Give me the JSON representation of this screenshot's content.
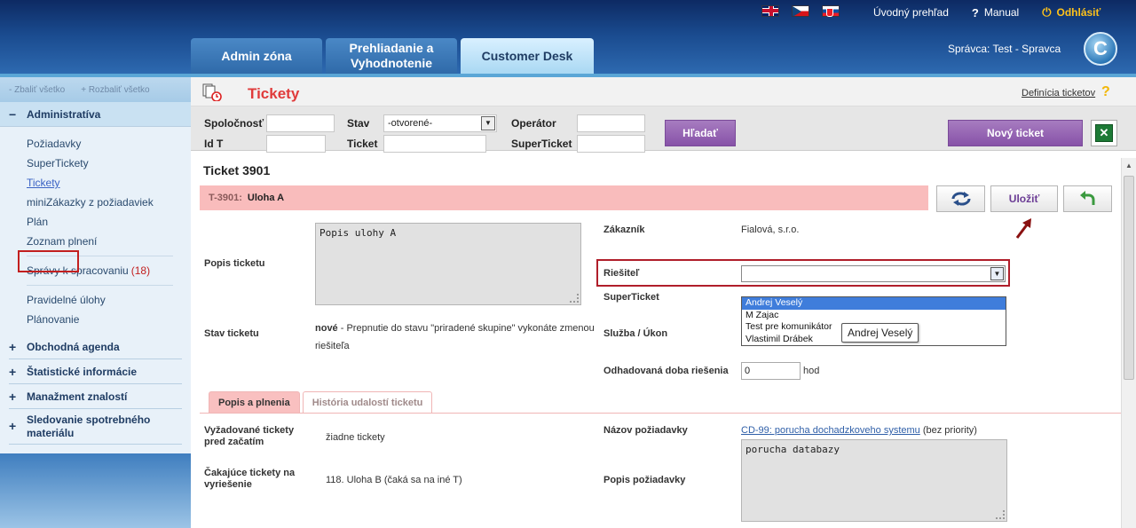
{
  "header": {
    "flags": [
      "uk-flag",
      "cz-flag",
      "sk-flag"
    ],
    "links": {
      "overview": "Úvodný prehľad",
      "manual": "Manual",
      "logout": "Odhlásiť"
    },
    "tabs": [
      {
        "label": "Admin zóna"
      },
      {
        "label": "Prehliadanie a Vyhodnotenie"
      },
      {
        "label": "Customer Desk"
      }
    ],
    "admin": "Správca: Test - Spravca",
    "logo_letter": "C"
  },
  "sidebar": {
    "collapse_all": "- Zbaliť všetko",
    "expand_all": "+ Rozbaliť všetko",
    "groups": [
      {
        "label": "Administratíva",
        "sign": "−"
      },
      {
        "label": "Obchodná agenda",
        "sign": "+"
      },
      {
        "label": "Štatistické informácie",
        "sign": "+"
      },
      {
        "label": "Manažment znalostí",
        "sign": "+"
      },
      {
        "label": "Sledovanie spotrebného materiálu",
        "sign": "+"
      }
    ],
    "items": [
      {
        "label": "Požiadavky"
      },
      {
        "label": "SuperTickety"
      },
      {
        "label": "Tickety"
      },
      {
        "label": "miniZákazky z požiadaviek"
      },
      {
        "label": "Plán"
      },
      {
        "label": "Zoznam plnení"
      },
      {
        "label": "Správy k spracovaniu",
        "count": "(18)"
      },
      {
        "label": "Pravidelné úlohy"
      },
      {
        "label": "Plánovanie"
      }
    ]
  },
  "page": {
    "title": "Tickety",
    "definition_link": "Definícia ticketov",
    "help": "?"
  },
  "filters": {
    "company_label": "Spoločnosť",
    "company_value": "",
    "status_label": "Stav",
    "status_value": "-otvorené-",
    "operator_label": "Operátor",
    "operator_value": "",
    "idt_label": "Id T",
    "idt_value": "",
    "ticket_label": "Ticket",
    "ticket_value": "",
    "superticket_label": "SuperTicket",
    "superticket_value": "",
    "search_button": "Hľadať",
    "new_ticket_button": "Nový ticket"
  },
  "ticket": {
    "heading": "Ticket 3901",
    "bar_id": "T-3901:",
    "bar_name": "Uloha A",
    "save_button": "Uložiť",
    "description_label": "Popis ticketu",
    "description_value": "Popis ulohy A",
    "status_label": "Stav ticketu",
    "status_value_bold": "nové",
    "status_value_note": " - Prepnutie do stavu \"priradené skupine\" vykonáte zmenou riešiteľa",
    "customer_label": "Zákazník",
    "customer_value": "Fialová, s.r.o.",
    "solver_label": "Riešiteľ",
    "solver_value": "",
    "solver_options": [
      "Andrej Veselý",
      "M Zajac",
      "Test pre komunikátor",
      "Vlastimil Drábek"
    ],
    "solver_tooltip": "Andrej Veselý",
    "superticket_label": "SuperTicket",
    "service_label": "Služba / Úkon",
    "estimate_label": "Odhadovaná doba riešenia",
    "estimate_value": "0",
    "estimate_unit": "hod"
  },
  "subtabs": {
    "tab1": "Popis a plnenia",
    "tab2": "História udalostí ticketu"
  },
  "details": {
    "required_label": "Vyžadované tickety pred začatím",
    "required_value": "žiadne tickety",
    "waiting_label": "Čakajúce tickety na vyriešenie",
    "waiting_value": "118.  Uloha B (čaká sa na iné T)",
    "request_name_label": "Názov požiadavky",
    "request_name_link": "CD-99: porucha dochadzkoveho systemu",
    "request_name_suffix": " (bez priority)",
    "request_desc_label": "Popis požiadavky",
    "request_desc_value": "porucha databazy"
  },
  "colors": {
    "header_dark": "#0d2a63",
    "title_red": "#e03b3b",
    "purple_button": "#8752a8",
    "ticket_bar": "#f9bcbc",
    "highlight_red": "#b01e2a"
  }
}
